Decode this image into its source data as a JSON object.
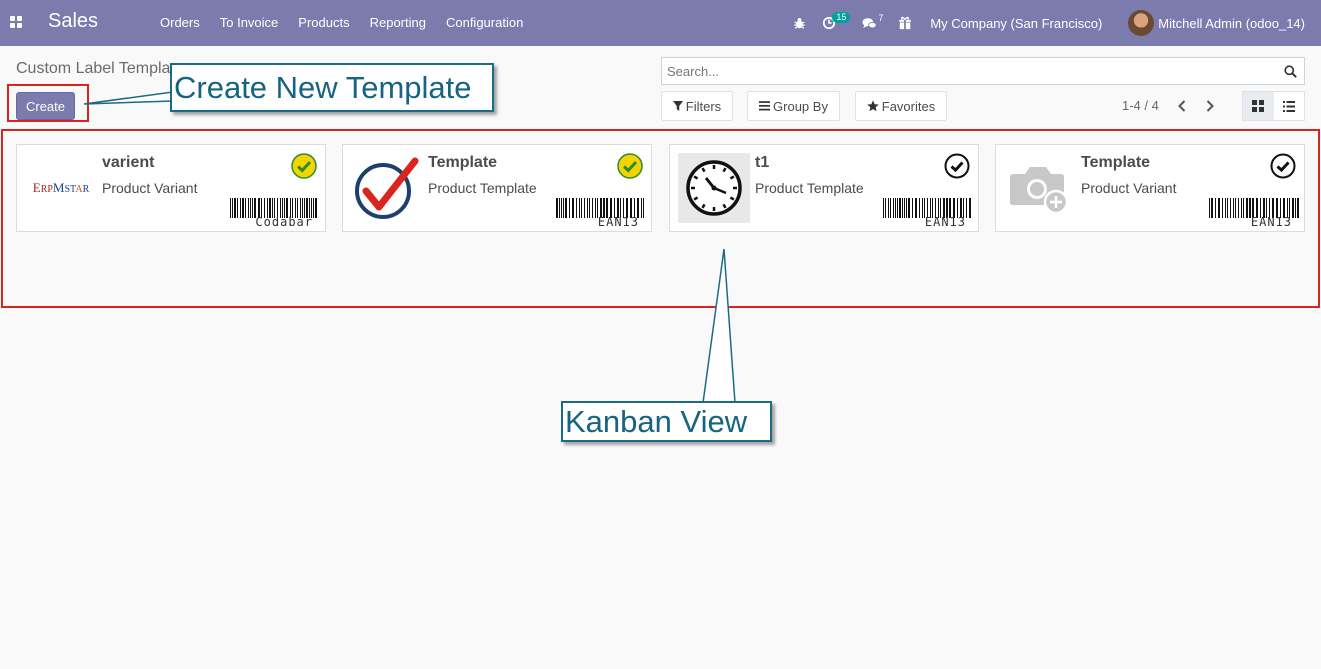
{
  "navbar": {
    "app_name": "Sales",
    "menu": [
      "Orders",
      "To Invoice",
      "Products",
      "Reporting",
      "Configuration"
    ],
    "activity_count": "15",
    "messages_count": "7",
    "company": "My Company (San Francisco)",
    "user": "Mitchell Admin (odoo_14)",
    "bg_color": "#7c7bad"
  },
  "control_panel": {
    "breadcrumb": "Custom Label Templates",
    "create_label": "Create",
    "search_placeholder": "Search...",
    "filters_label": "Filters",
    "groupby_label": "Group By",
    "favorites_label": "Favorites",
    "pager": "1-4 / 4",
    "active_view": "kanban"
  },
  "kanban": {
    "cards": [
      {
        "title": "varient",
        "subtitle": "Product Variant",
        "barcode_type": "Codabar",
        "image": "ErpMstar logo",
        "logo_text": "ErpMstar",
        "checked_style": "yellow-check"
      },
      {
        "title": "Template",
        "subtitle": "Product Template",
        "barcode_type": "EAN13",
        "image": "red check mark",
        "checked_style": "yellow-check"
      },
      {
        "title": "t1",
        "subtitle": "Product Template",
        "barcode_type": "EAN13",
        "image": "clock",
        "checked_style": "outline-check"
      },
      {
        "title": "Template",
        "subtitle": "Product Variant",
        "barcode_type": "EAN13",
        "image": "camera placeholder",
        "checked_style": "outline-check"
      }
    ]
  },
  "annotations": {
    "create_callout": "Create New Template",
    "kanban_callout": "Kanban View",
    "highlight_color": "#d9231e",
    "callout_color": "#16647f"
  }
}
